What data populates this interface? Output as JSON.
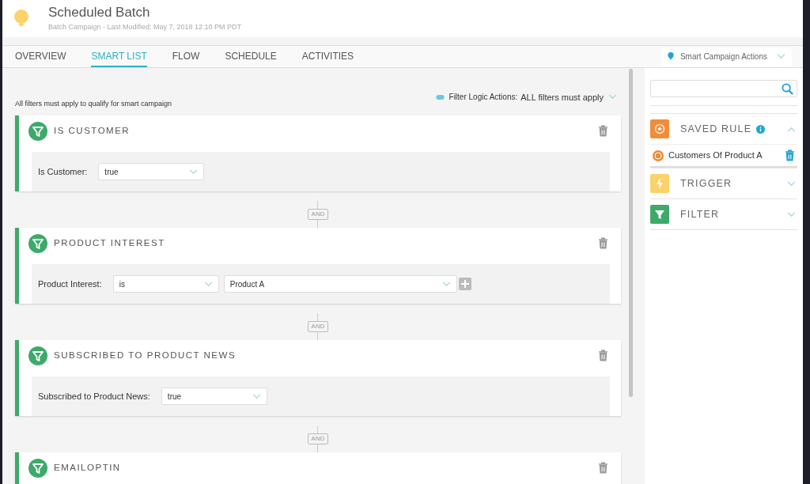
{
  "header": {
    "title": "Scheduled Batch",
    "subtitle": "Batch Campaign - Last Modified: May 7, 2018 12:10 PM PDT"
  },
  "tabs": [
    {
      "label": "OVERVIEW",
      "selected": false
    },
    {
      "label": "SMART LIST",
      "selected": true
    },
    {
      "label": "FLOW",
      "selected": false
    },
    {
      "label": "SCHEDULE",
      "selected": false
    },
    {
      "label": "ACTIVITIES",
      "selected": false
    }
  ],
  "actions_menu": {
    "label": "Smart Campaign Actions"
  },
  "rule_note": "All filters must apply to qualify for smart campaign",
  "filter_logic": {
    "label": "Filter Logic Actions:",
    "value": "ALL filters must apply"
  },
  "filters": [
    {
      "title": "IS CUSTOMER",
      "label": "Is Customer:",
      "selects": [
        {
          "value": "true",
          "wide": false
        }
      ],
      "add_button": false
    },
    {
      "connector": "AND",
      "title": "PRODUCT INTEREST",
      "label": "Product Interest:",
      "selects": [
        {
          "value": "is",
          "wide": false
        },
        {
          "value": "Product A",
          "wide": true
        }
      ],
      "add_button": true
    },
    {
      "connector": "AND",
      "title": "SUBSCRIBED TO PRODUCT NEWS",
      "label": "Subscribed to Product News:",
      "selects": [
        {
          "value": "true",
          "wide": false
        }
      ],
      "add_button": false
    },
    {
      "connector": "AND",
      "title": "EMAILOPTIN"
    }
  ],
  "sidebar": {
    "sections": [
      {
        "kind": "saved",
        "label": "SAVED RULE",
        "color": "#f28c38",
        "info": true,
        "expanded": true,
        "items": [
          "Customers Of Product A"
        ]
      },
      {
        "kind": "trigger",
        "label": "TRIGGER",
        "color": "#fcd36a",
        "info": false,
        "expanded": false
      },
      {
        "kind": "filter",
        "label": "FILTER",
        "color": "#3daa6a",
        "info": false,
        "expanded": false
      }
    ]
  }
}
